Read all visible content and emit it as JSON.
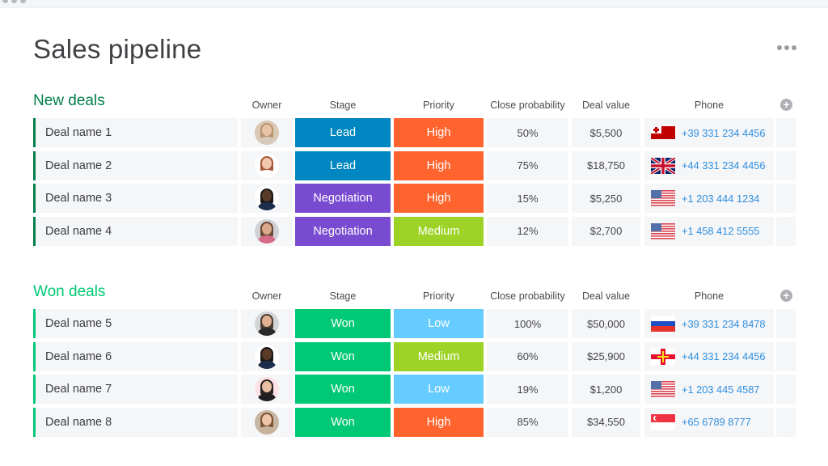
{
  "page": {
    "title": "Sales pipeline",
    "more_menu_icon": "more-horizontal-icon"
  },
  "columns": {
    "owner": "Owner",
    "stage": "Stage",
    "priority": "Priority",
    "close_probability": "Close probability",
    "deal_value": "Deal value",
    "phone": "Phone",
    "add_column_icon": "plus-circle-icon"
  },
  "colors": {
    "new_group": "#037f4c",
    "won_group": "#00c875",
    "stage_lead": "#0086c0",
    "stage_negotiation": "#784bd1",
    "stage_won": "#00c875",
    "priority_high": "#ff642e",
    "priority_medium": "#9cd326",
    "priority_low": "#579bfc",
    "priority_low_light": "#66ccff",
    "phone_link": "#2f8fe0"
  },
  "groups": [
    {
      "title": "New deals",
      "color": "#037f4c",
      "rows": [
        {
          "name": "Deal name 1",
          "owner": "woman-blonde",
          "stage": "Lead",
          "stage_color": "#0086c0",
          "priority": "High",
          "priority_color": "#ff642e",
          "probability": "50%",
          "value": "$5,500",
          "flag": "tonga",
          "phone": "+39 331 234 4456"
        },
        {
          "name": "Deal name 2",
          "owner": "woman-red-hair",
          "stage": "Lead",
          "stage_color": "#0086c0",
          "priority": "High",
          "priority_color": "#ff642e",
          "probability": "75%",
          "value": "$18,750",
          "flag": "uk",
          "phone": "+44 331 234 4456"
        },
        {
          "name": "Deal name 3",
          "owner": "man-dark",
          "stage": "Negotiation",
          "stage_color": "#784bd1",
          "priority": "High",
          "priority_color": "#ff642e",
          "probability": "15%",
          "value": "$5,250",
          "flag": "usa",
          "phone": "+1 203 444 1234"
        },
        {
          "name": "Deal name 4",
          "owner": "man-beard",
          "stage": "Negotiation",
          "stage_color": "#784bd1",
          "priority": "Medium",
          "priority_color": "#9cd326",
          "probability": "12%",
          "value": "$2,700",
          "flag": "usa",
          "phone": "+1 458 412 5555"
        }
      ]
    },
    {
      "title": "Won deals",
      "color": "#00c875",
      "rows": [
        {
          "name": "Deal name 5",
          "owner": "man-stubble",
          "stage": "Won",
          "stage_color": "#00c875",
          "priority": "Low",
          "priority_color": "#66ccff",
          "probability": "100%",
          "value": "$50,000",
          "flag": "russia",
          "phone": "+39 331 234 8478"
        },
        {
          "name": "Deal name 6",
          "owner": "man-dark",
          "stage": "Won",
          "stage_color": "#00c875",
          "priority": "Medium",
          "priority_color": "#9cd326",
          "probability": "60%",
          "value": "$25,900",
          "flag": "guernsey",
          "phone": "+44 331 234 4456"
        },
        {
          "name": "Deal name 7",
          "owner": "woman-dark-hair",
          "stage": "Won",
          "stage_color": "#00c875",
          "priority": "Low",
          "priority_color": "#66ccff",
          "probability": "19%",
          "value": "$1,200",
          "flag": "usa",
          "phone": "+1 203 445 4587"
        },
        {
          "name": "Deal name 8",
          "owner": "woman-brown-hair",
          "stage": "Won",
          "stage_color": "#00c875",
          "priority": "High",
          "priority_color": "#ff642e",
          "probability": "85%",
          "value": "$34,550",
          "flag": "singapore",
          "phone": "+65 6789 8777"
        }
      ]
    }
  ]
}
